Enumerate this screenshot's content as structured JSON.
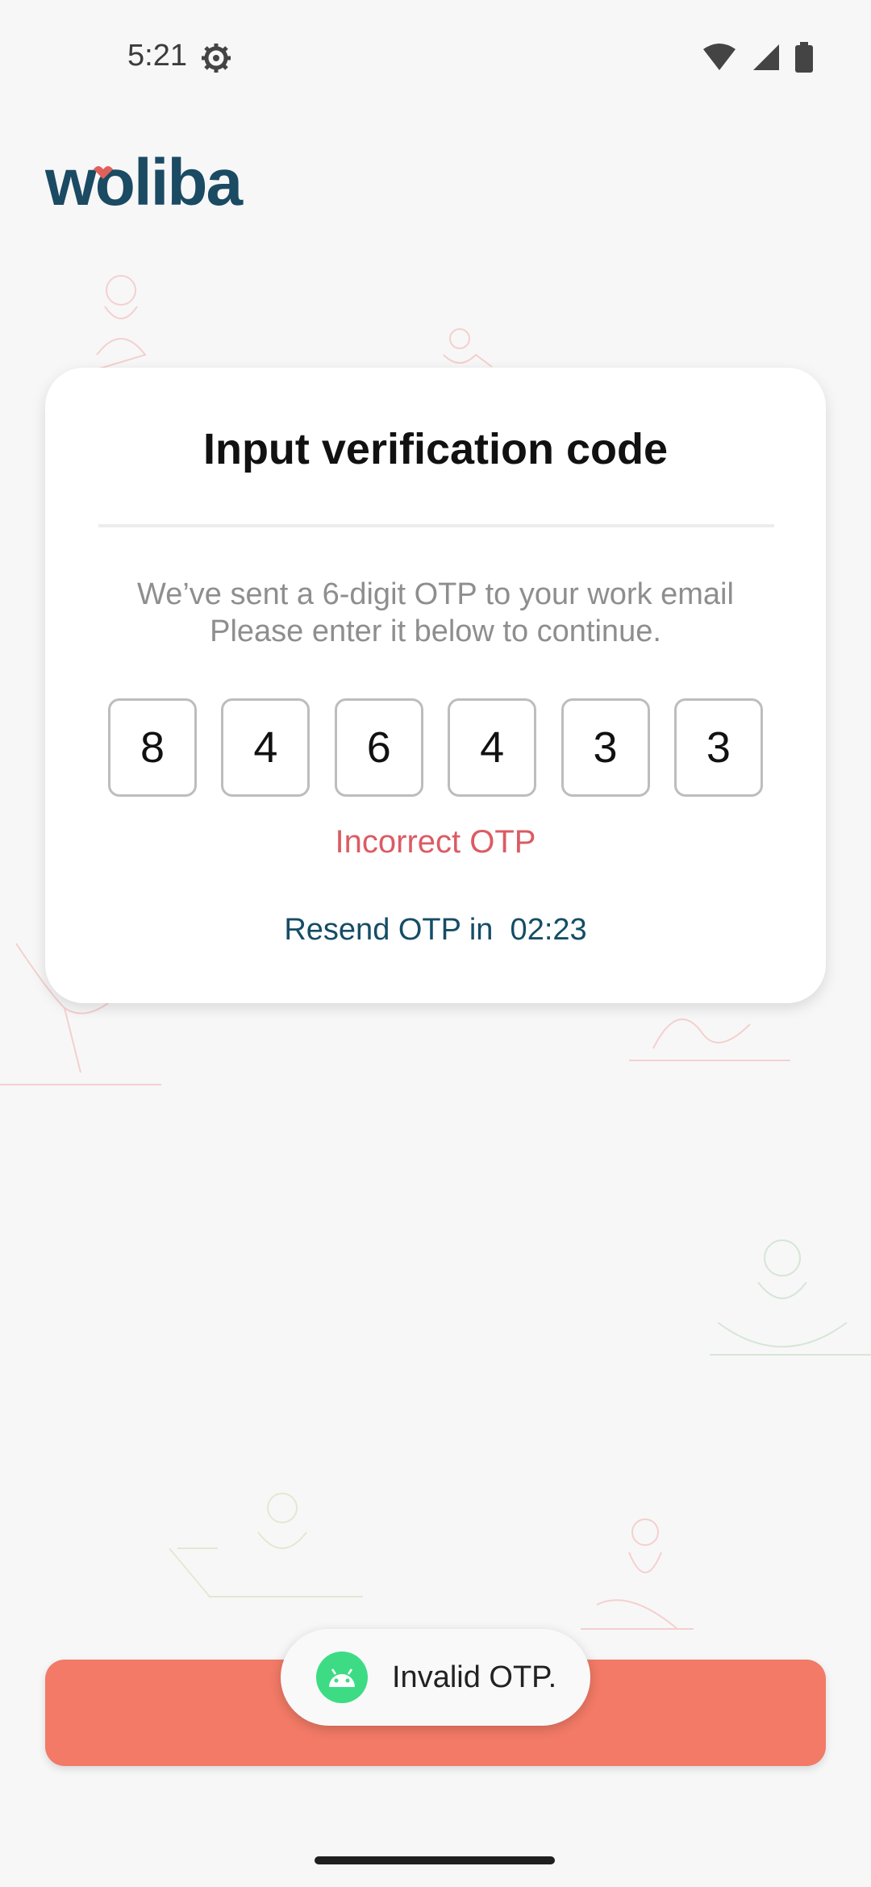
{
  "status_bar": {
    "time": "5:21",
    "icons": [
      "settings-gear-icon",
      "wifi-icon",
      "cell-signal-icon",
      "battery-icon"
    ]
  },
  "brand": {
    "logo_text": "woliba",
    "logo_color": "#1b4a63",
    "logo_accent": "#e0605a"
  },
  "card": {
    "title": "Input verification code",
    "description_line1": "We’ve sent a 6-digit OTP to your work email",
    "description_line2": "Please enter it below to continue.",
    "otp_digits": [
      "8",
      "4",
      "6",
      "4",
      "3",
      "3"
    ],
    "error_text": "Incorrect OTP",
    "resend_label": "Resend OTP in  02:23"
  },
  "primary_button": {
    "label": "",
    "color": "#f27a66"
  },
  "toast": {
    "text": "Invalid OTP.",
    "icon": "android-icon"
  }
}
